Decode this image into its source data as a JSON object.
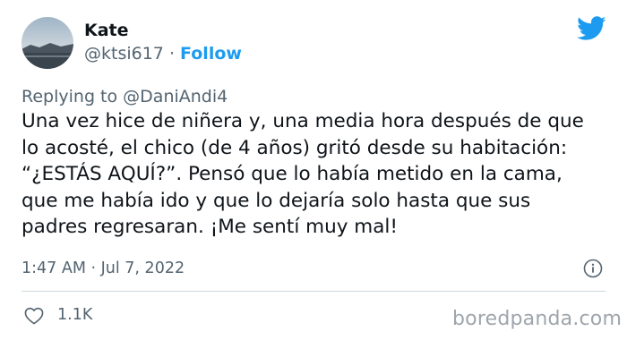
{
  "author": {
    "name": "Kate",
    "handle": "@ktsi617",
    "separator": "·",
    "follow_label": "Follow"
  },
  "reply": {
    "prefix": "Replying to",
    "mention": "@DaniAndi4"
  },
  "tweet": {
    "lines": [
      "Una vez hice de niñera y, una media hora después de que",
      "lo acosté, el chico (de 4 años) gritó desde su habitación:",
      "“¿ESTÁS AQUÍ?”. Pensó que lo había metido en la cama,",
      "que me había ido y que lo dejaría solo hasta que sus",
      "padres regresaran. ¡Me sentí muy mal!"
    ]
  },
  "meta": {
    "timestamp": "1:47 AM · Jul 7, 2022"
  },
  "stats": {
    "likes": "1.1K"
  },
  "watermark": "boredpanda.com",
  "colors": {
    "accent": "#1d9bf0",
    "text": "#0f1419",
    "muted": "#536471"
  }
}
